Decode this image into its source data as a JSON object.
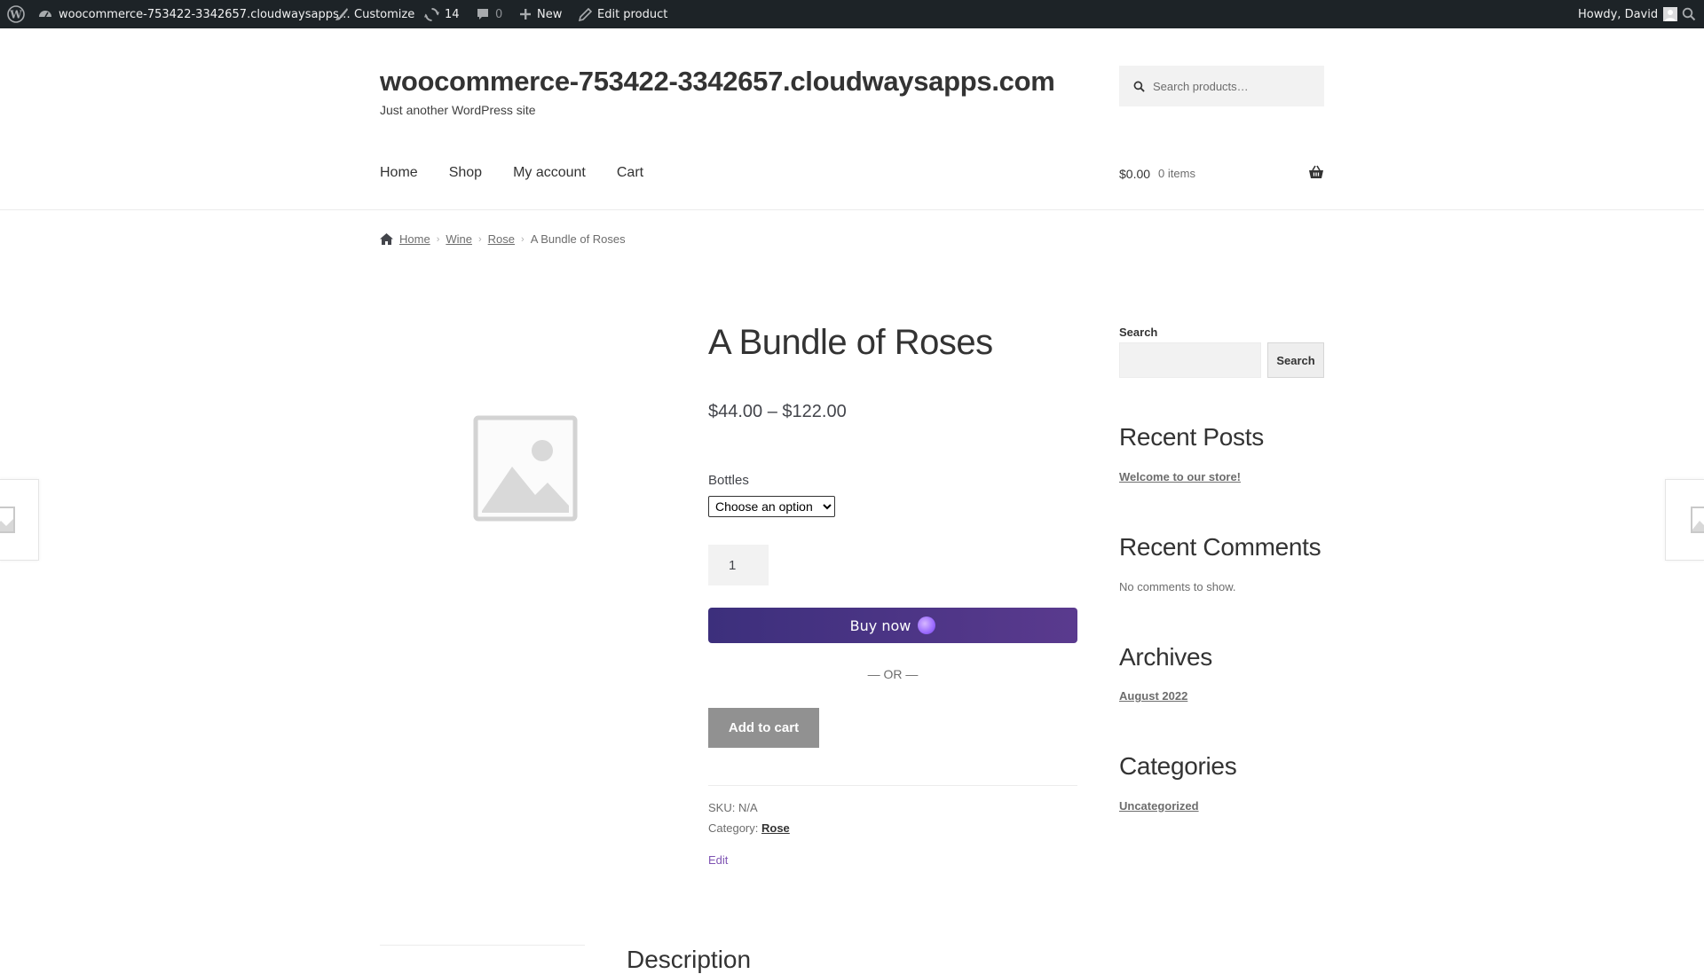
{
  "admin_bar": {
    "site_name": "woocommerce-753422-3342657.cloudwaysapps…",
    "customize": "Customize",
    "updates": "14",
    "comments": "0",
    "new": "New",
    "edit_product": "Edit product",
    "howdy": "Howdy, David"
  },
  "header": {
    "site_title": "woocommerce-753422-3342657.cloudwaysapps.com",
    "tagline": "Just another WordPress site",
    "search_placeholder": "Search products…",
    "nav": [
      "Home",
      "Shop",
      "My account",
      "Cart"
    ],
    "cart_total": "$0.00",
    "cart_items": "0 items"
  },
  "breadcrumb": [
    "Home",
    "Wine",
    "Rose",
    "A Bundle of Roses"
  ],
  "product": {
    "title": "A Bundle of Roses",
    "price": "$44.00 – $122.00",
    "variation_label": "Bottles",
    "variation_selected": "Choose an option",
    "quantity": "1",
    "buy_now": "Buy now",
    "or": "— OR —",
    "add_to_cart": "Add to cart",
    "sku": "SKU: N/A",
    "category_label": "Category:",
    "category": "Rose",
    "edit": "Edit"
  },
  "sidebar": {
    "search_label": "Search",
    "search_button": "Search",
    "recent_posts_heading": "Recent Posts",
    "recent_post": "Welcome to our store!",
    "recent_comments_heading": "Recent Comments",
    "no_comments": "No comments to show.",
    "archives_heading": "Archives",
    "archive": "August 2022",
    "categories_heading": "Categories",
    "category": "Uncategorized"
  },
  "tabs": {
    "description": "Description"
  },
  "colors": {
    "admin_bar": "#1d2327",
    "buy_now_start": "#3c2f7c",
    "buy_now_end": "#5a3a8e",
    "add_to_cart": "#919191",
    "edit_link": "#7f54b3"
  }
}
